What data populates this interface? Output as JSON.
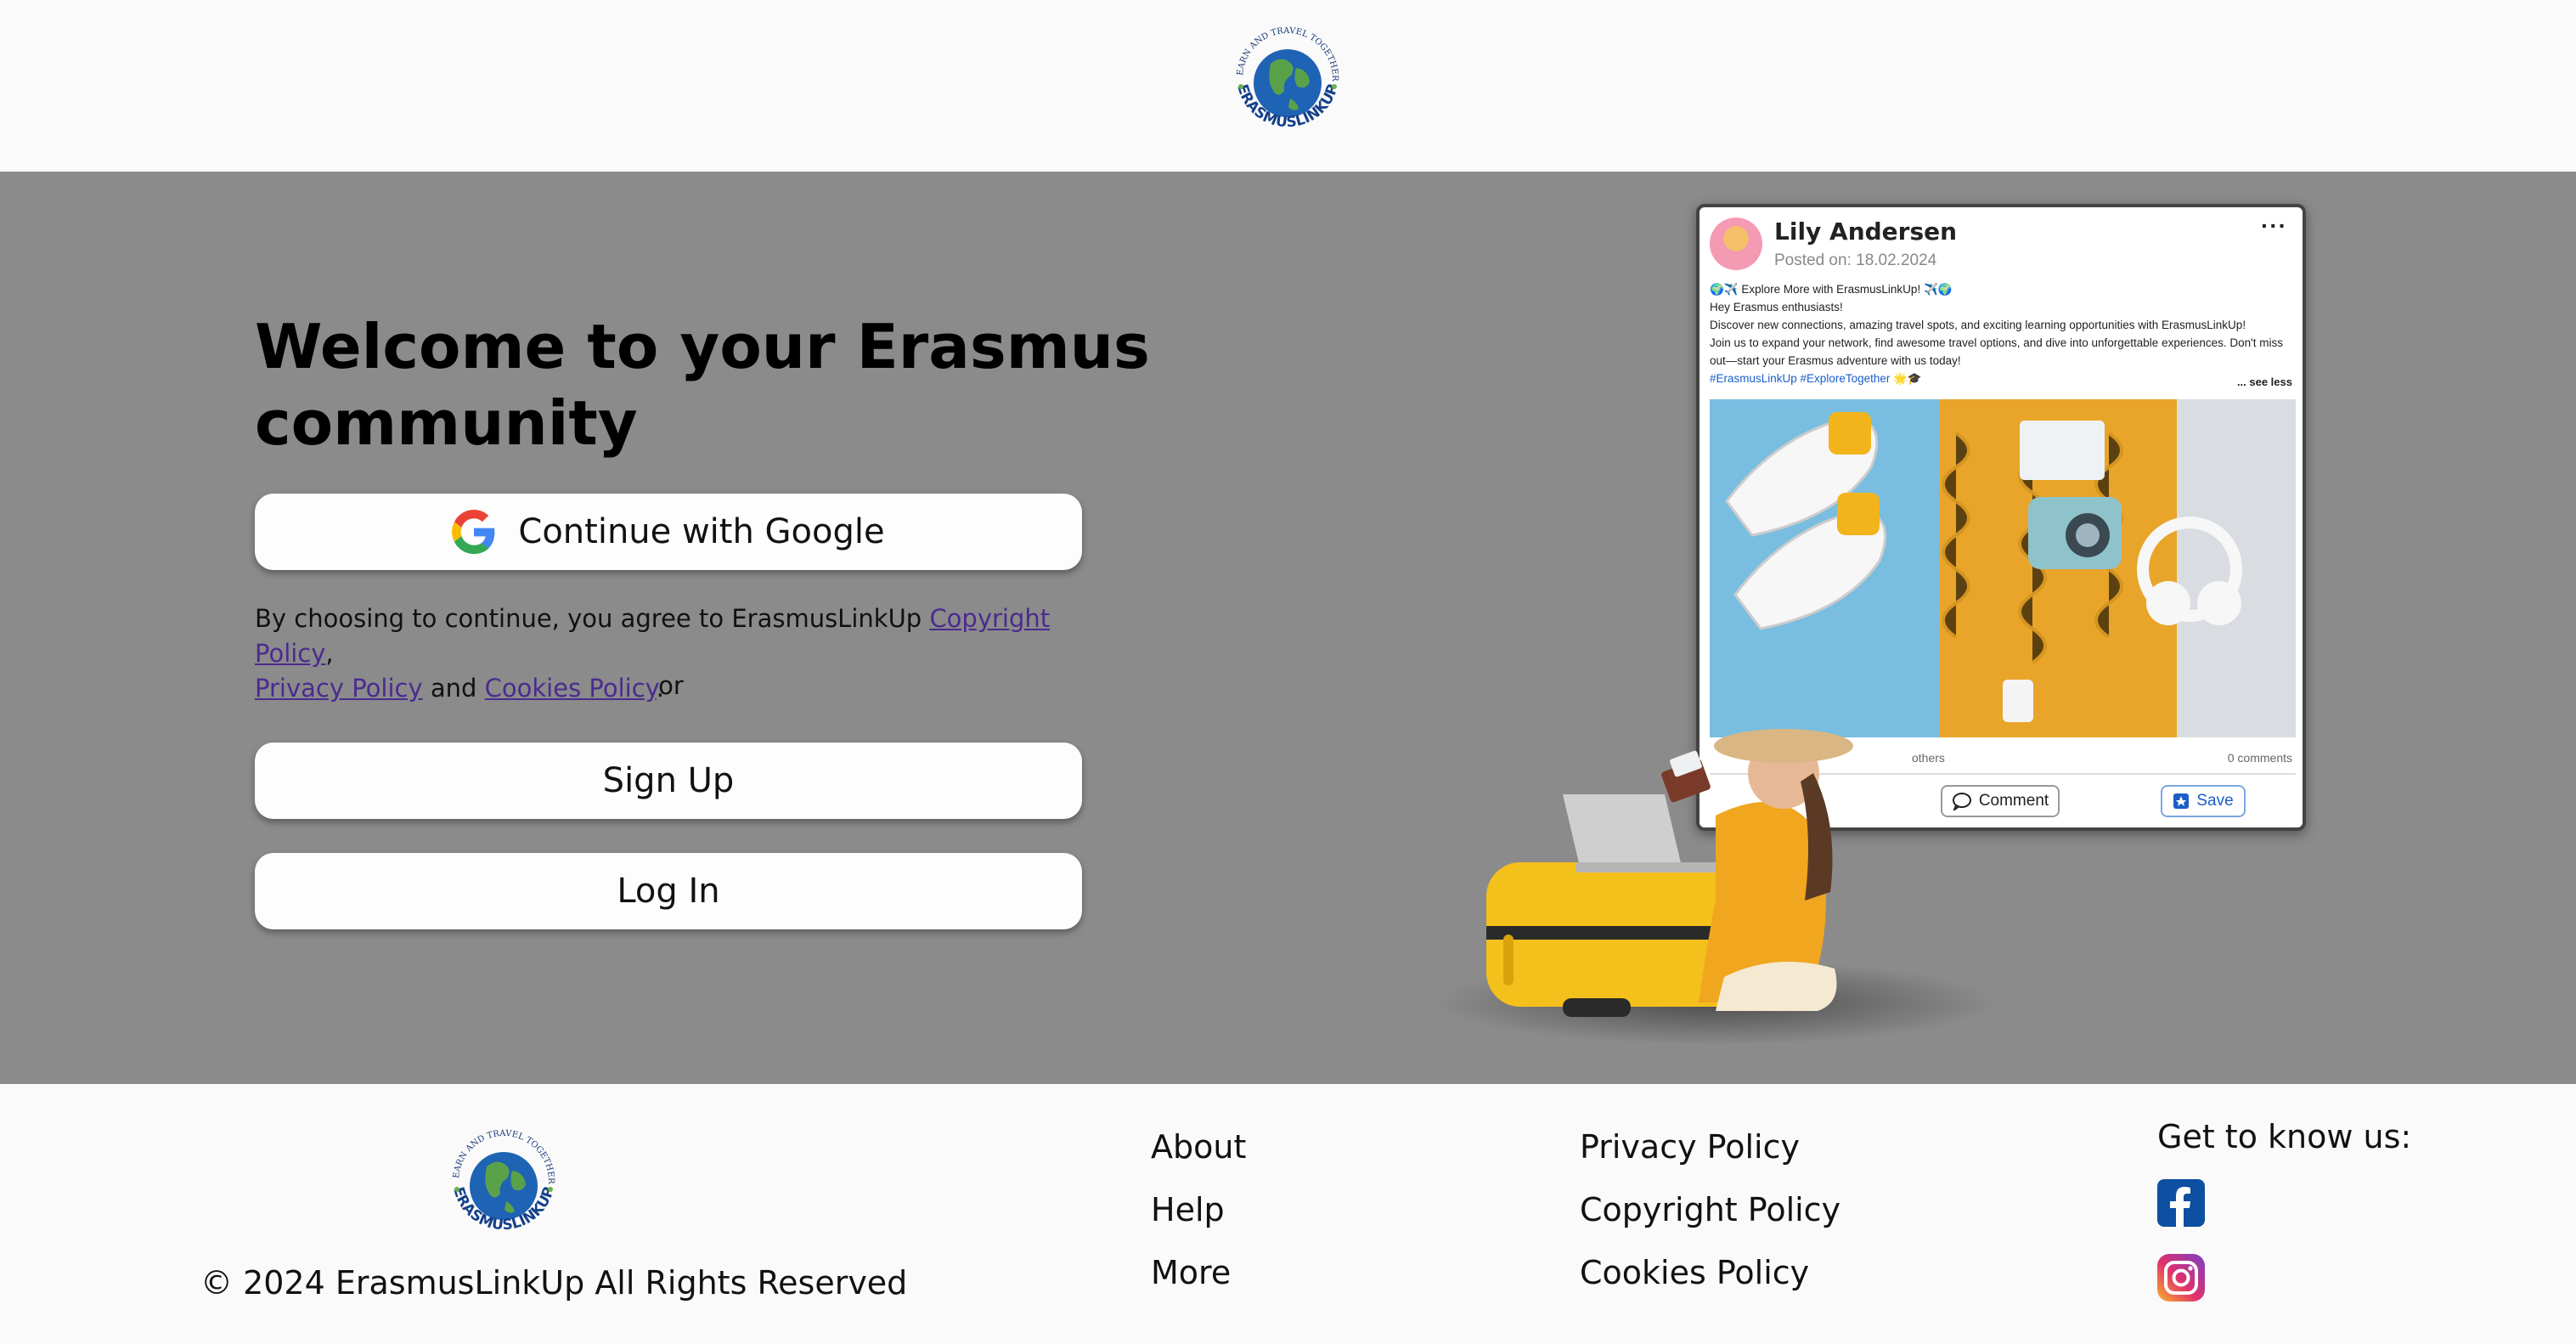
{
  "header": {
    "logo_alt": "ErasmusLinkUp",
    "logo_tagline": "LEARN AND TRAVEL TOGETHER",
    "logo_wordmark": "ERASMUSLINKUP"
  },
  "hero": {
    "title": "Welcome to your Erasmus community",
    "google_button": "Continue with Google",
    "consent_prefix": "By choosing to continue, you agree to ErasmusLinkUp ",
    "consent_link_copyright": "Copyright Policy",
    "consent_comma": ",",
    "consent_link_privacy": "Privacy Policy",
    "consent_and": " and ",
    "consent_link_cookies": "Cookies Policy",
    "consent_period": ".",
    "or": "or",
    "signup_button": "Sign Up",
    "login_button": "Log In"
  },
  "post": {
    "author": "Lily Andersen",
    "date": "Posted on: 18.02.2024",
    "more": "···",
    "line1": "🌍✈️ Explore More with ErasmusLinkUp! ✈️🌍",
    "line2": "Hey Erasmus enthusiasts!",
    "line3": "Discover new connections, amazing travel spots, and exciting learning opportunities with ErasmusLinkUp!",
    "line4": "Join us to expand your network, find awesome travel options, and dive into unforgettable experiences. Don't miss out—start your Erasmus adventure with us today!",
    "tags": "#ErasmusLinkUp #ExploreTogether 🌟🎓",
    "see_less": "... see less",
    "likes": "others",
    "comments": "0 comments",
    "comment_button": "Comment",
    "save_button": "Save"
  },
  "footer": {
    "copyright": "© 2024 ErasmusLinkUp All Rights Reserved",
    "col1": [
      "About",
      "Help",
      "More"
    ],
    "col2": [
      "Privacy Policy",
      "Copyright Policy",
      "Cookies Policy"
    ],
    "social_heading": "Get to know us:",
    "social": [
      "facebook-icon",
      "instagram-icon"
    ]
  },
  "colors": {
    "hero_bg": "#8b8b8b",
    "header_bg": "#fafafa",
    "link": "#4b2b8f",
    "facebook": "#0d4fa0",
    "accent_yellow": "#f2b500"
  }
}
